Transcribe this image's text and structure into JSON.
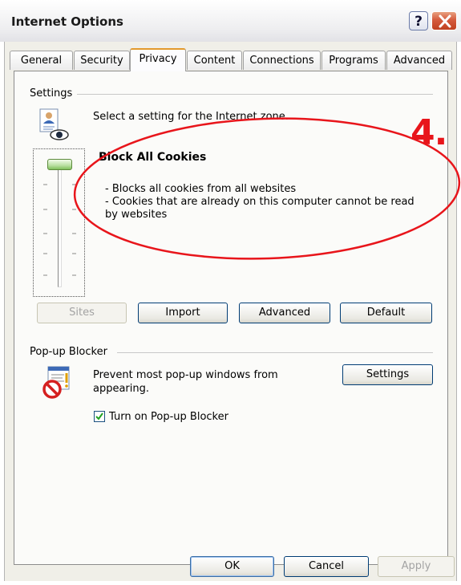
{
  "window": {
    "title": "Internet Options"
  },
  "tabs": [
    {
      "label": "General"
    },
    {
      "label": "Security"
    },
    {
      "label": "Privacy"
    },
    {
      "label": "Content"
    },
    {
      "label": "Connections"
    },
    {
      "label": "Programs"
    },
    {
      "label": "Advanced"
    }
  ],
  "settings": {
    "group_label": "Settings",
    "intro": "Select a setting for the Internet zone.",
    "level_title": "Block All Cookies",
    "desc_line1": "- Blocks all cookies from all websites",
    "desc_line2": "- Cookies that are already on this computer cannot be read",
    "desc_line3": "by websites",
    "slider_level": 1.0,
    "buttons": {
      "sites": "Sites",
      "import": "Import",
      "advanced": "Advanced",
      "default": "Default"
    }
  },
  "popup": {
    "group_label": "Pop-up Blocker",
    "desc_line1": "Prevent most pop-up windows from",
    "desc_line2": "appearing.",
    "settings_button": "Settings",
    "checkbox_label": "Turn on Pop-up Blocker",
    "checked": true
  },
  "footer": {
    "ok": "OK",
    "cancel": "Cancel",
    "apply": "Apply"
  },
  "annotation": {
    "label": "4.",
    "color": "#e8151b"
  }
}
